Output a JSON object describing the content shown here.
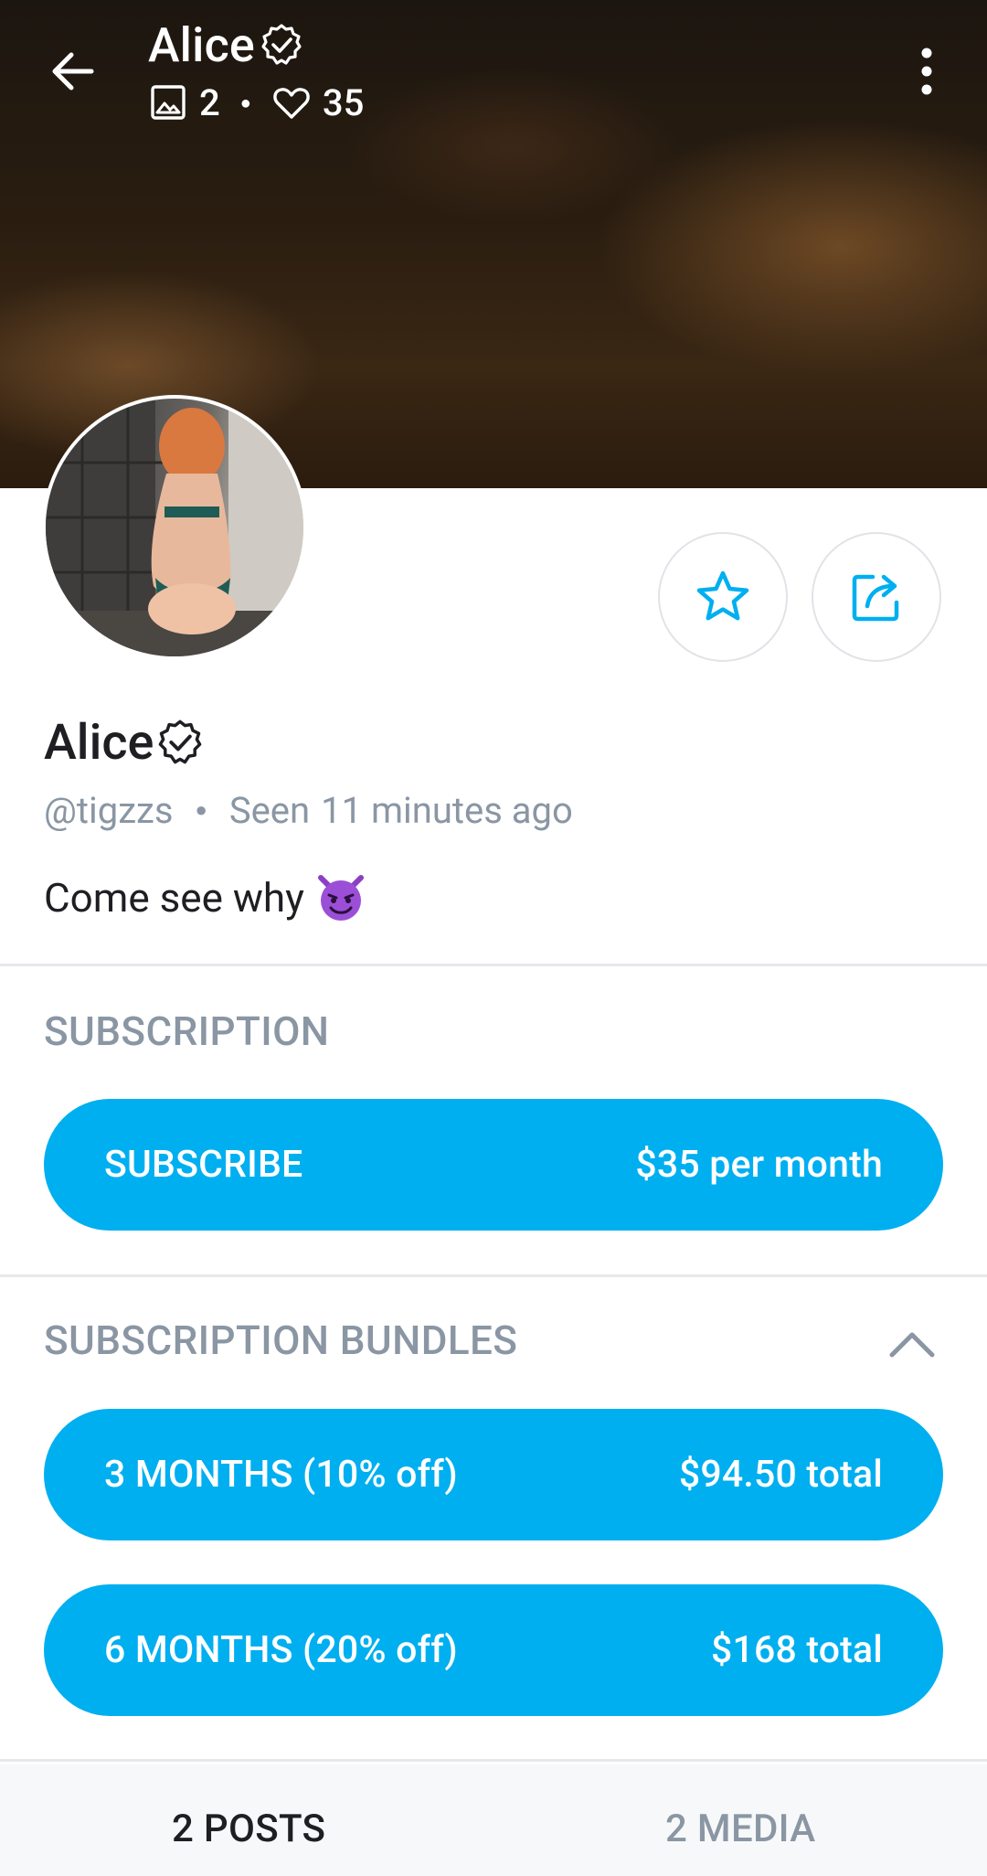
{
  "header": {
    "title": "Alice",
    "photos_count": "2",
    "likes_count": "35"
  },
  "profile": {
    "name": "Alice",
    "handle": "@tigzzs",
    "seen_label": "Seen",
    "seen_time": "11 minutes ago",
    "bio": "Come see why"
  },
  "subscription": {
    "section_title": "SUBSCRIPTION",
    "button_label": "SUBSCRIBE",
    "button_price": "$35 per month"
  },
  "bundles": {
    "section_title": "SUBSCRIPTION BUNDLES",
    "items": [
      {
        "label": "3 MONTHS (10% off)",
        "price": "$94.50 total"
      },
      {
        "label": "6 MONTHS (20% off)",
        "price": "$168 total"
      }
    ]
  },
  "tabs": [
    {
      "label": "2 POSTS"
    },
    {
      "label": "2 MEDIA"
    }
  ],
  "colors": {
    "accent": "#00aff0",
    "muted_text": "#8a96a3",
    "divider": "#e6e8ec"
  },
  "icons": {
    "back": "arrow-left-icon",
    "verified": "verified-badge-icon",
    "photos": "image-icon",
    "likes": "heart-icon",
    "more": "more-vertical-icon",
    "favorite": "star-icon",
    "share": "share-icon",
    "collapse": "chevron-up-icon",
    "bio_emoji": "smiling-devil-emoji"
  }
}
